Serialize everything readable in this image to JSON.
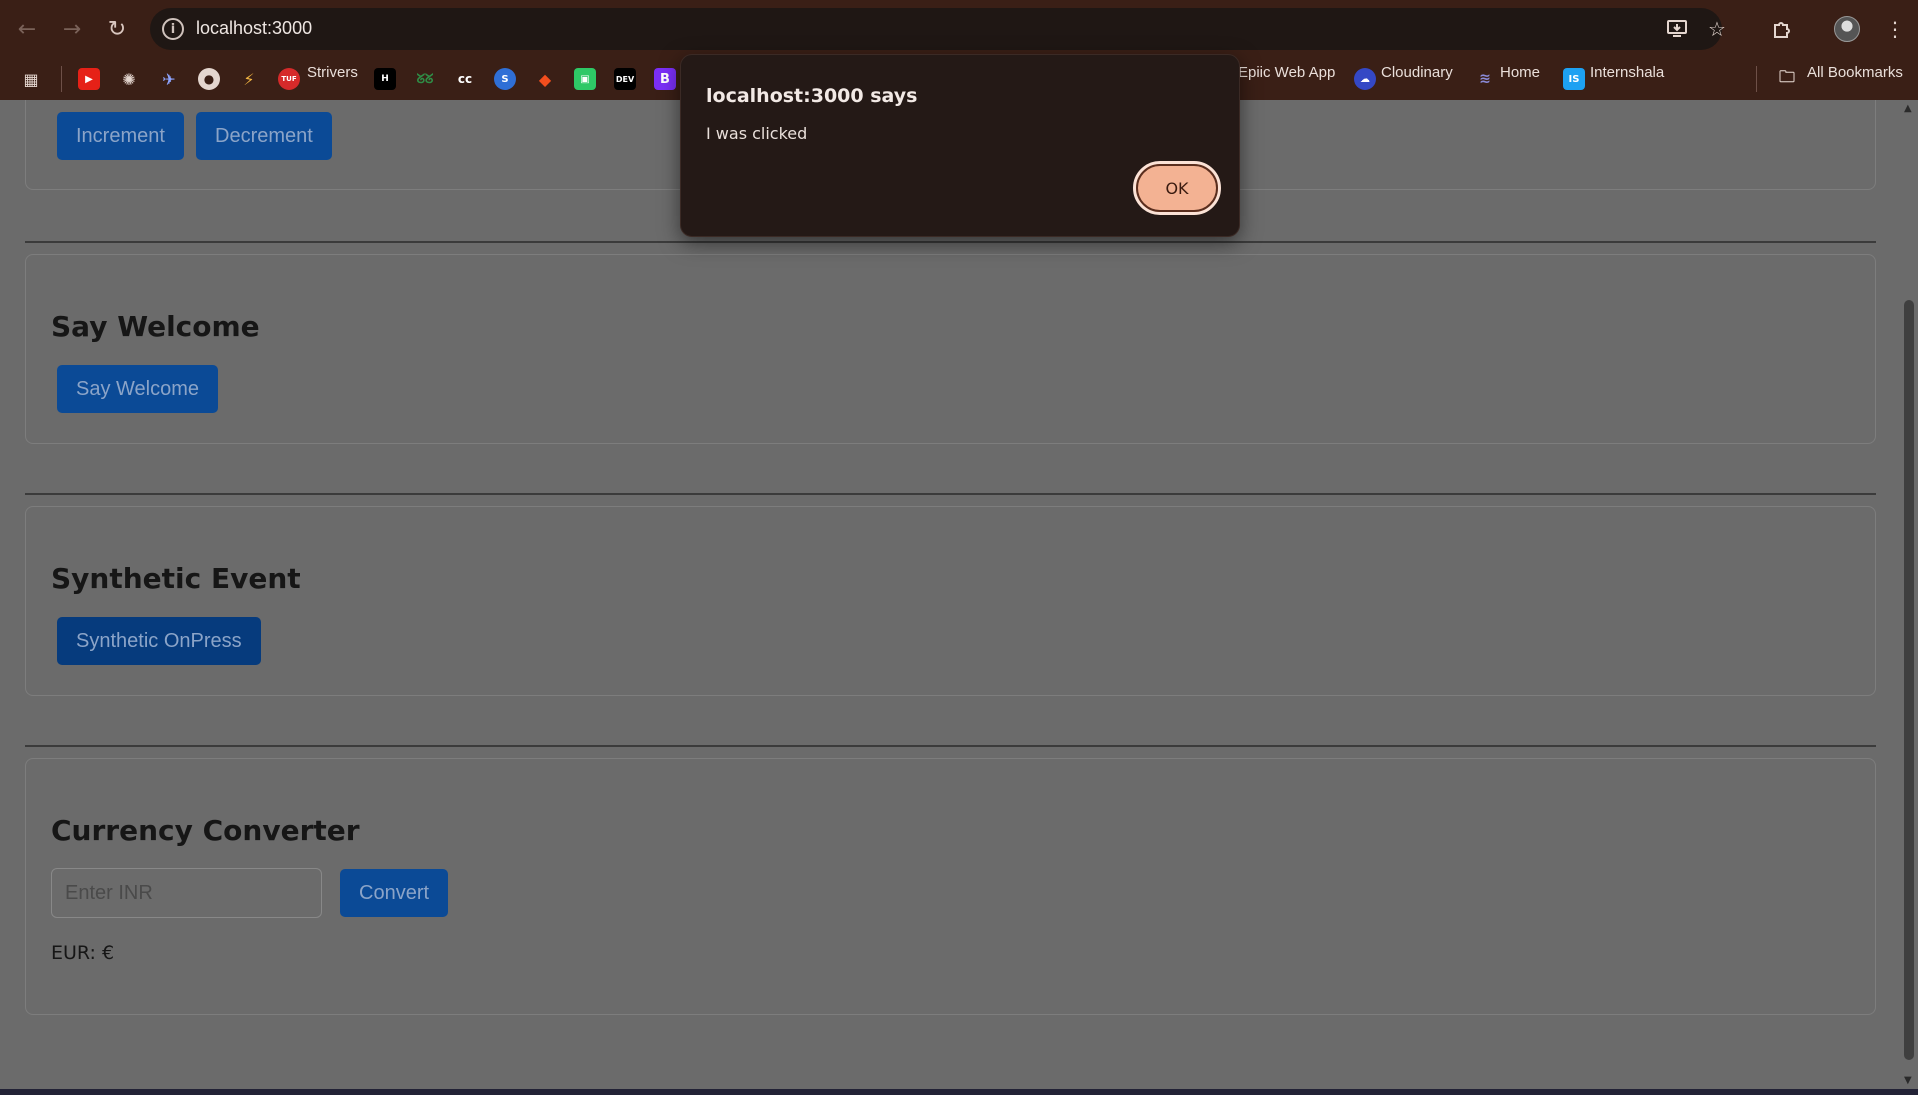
{
  "browser": {
    "url": "localhost:3000",
    "back_icon": "arrow-left-icon",
    "forward_icon": "arrow-right-icon",
    "reload_icon": "reload-icon",
    "site_info_icon": "info-icon"
  },
  "bookmarks": {
    "items": [
      {
        "label": "Strivers"
      },
      {
        "label": "Epiic Web App"
      },
      {
        "label": "Cloudinary"
      },
      {
        "label": "Home"
      },
      {
        "label": "Internshala"
      }
    ],
    "all_bookmarks": "All Bookmarks"
  },
  "counter": {
    "increment_label": "Increment",
    "decrement_label": "Decrement"
  },
  "welcome": {
    "title": "Say Welcome",
    "button_label": "Say Welcome"
  },
  "synthetic": {
    "title": "Synthetic Event",
    "button_label": "Synthetic OnPress"
  },
  "currency": {
    "title": "Currency Converter",
    "input_placeholder": "Enter INR",
    "convert_label": "Convert",
    "result": "EUR: €"
  },
  "dialog": {
    "title": "localhost:3000 says",
    "message": "I was clicked",
    "ok_label": "OK"
  },
  "colors": {
    "chrome": "#3a1f16",
    "dialog_bg": "#241916",
    "ok_button": "#f3b293",
    "primary_button": "#0b4a96"
  }
}
